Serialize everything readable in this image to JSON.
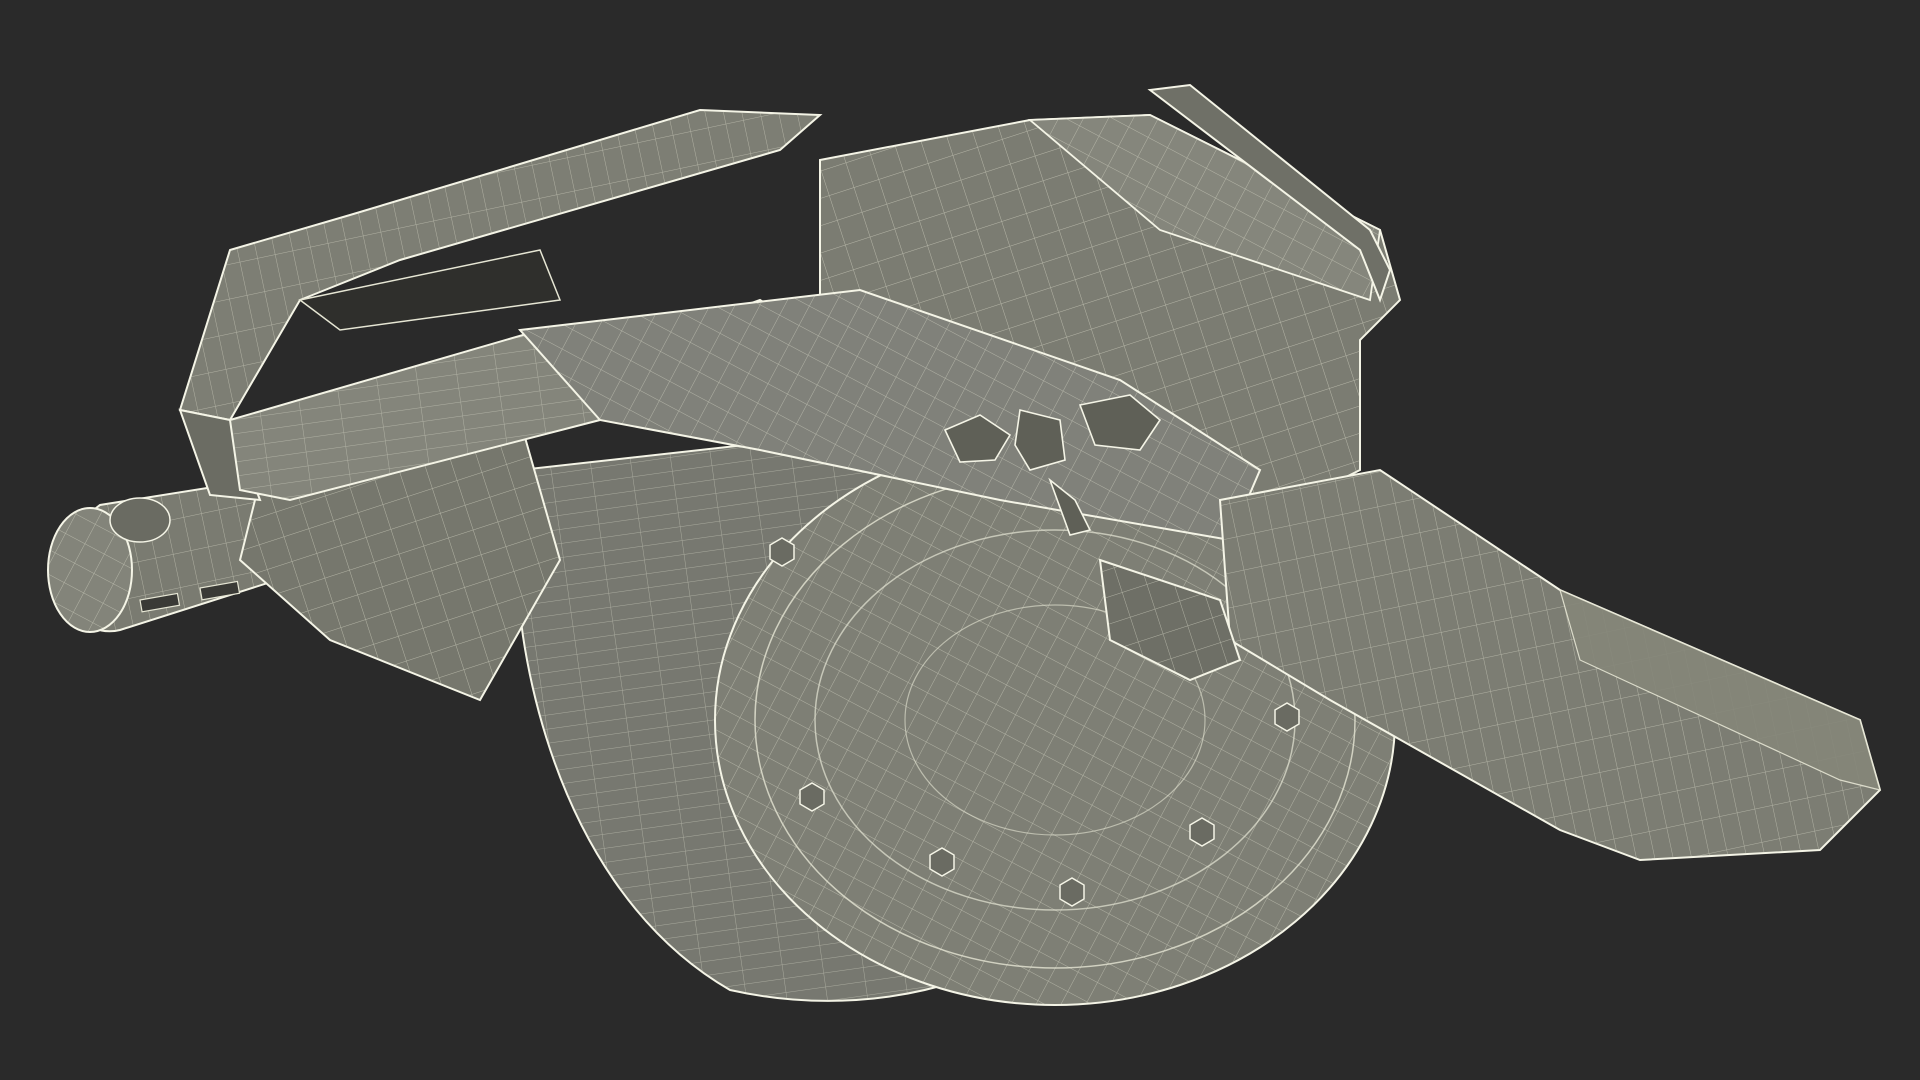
{
  "scene": {
    "subject": "wireframe-3d-model",
    "background_color": "#2a2a2a",
    "surface_color": "#7c7d72",
    "surface_dark_color": "#5f6057",
    "edge_color": "#e6e6d4",
    "rim_color": "#f4f4e6"
  }
}
